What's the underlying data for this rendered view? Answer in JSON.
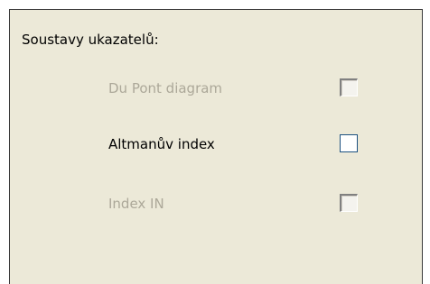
{
  "group": {
    "title": "Soustavy ukazatelů:"
  },
  "options": [
    {
      "label": "Du Pont diagram",
      "enabled": false,
      "checked": false
    },
    {
      "label": "Altmanův index",
      "enabled": true,
      "checked": false
    },
    {
      "label": "Index IN",
      "enabled": false,
      "checked": false
    }
  ],
  "colors": {
    "panel_background": "#ece9d8",
    "disabled_text": "#aca899",
    "enabled_text": "#000000",
    "checkbox_border": "#1c5180"
  }
}
